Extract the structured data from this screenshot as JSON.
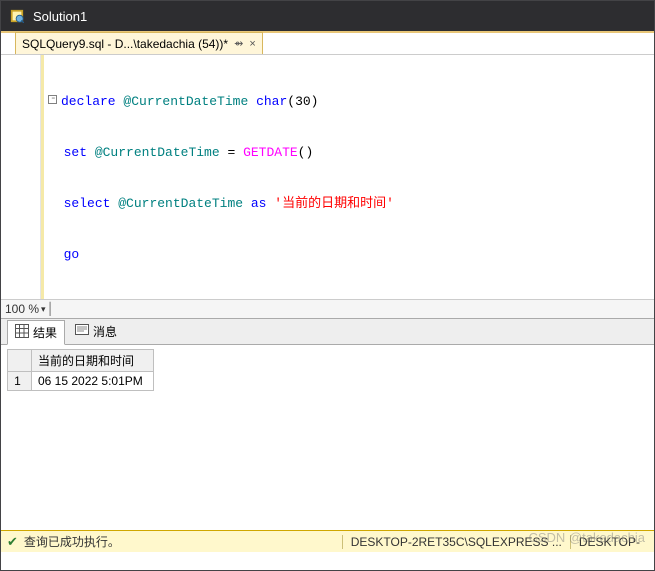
{
  "title_bar": {
    "text": "Solution1"
  },
  "doc_tab": {
    "label": "SQLQuery9.sql - D...\\takedachia (54))*",
    "pin_glyph": "⇴",
    "close_glyph": "×"
  },
  "code": {
    "line1_kw1": "declare",
    "line1_var": "@CurrentDateTime",
    "line1_ty": "char",
    "line1_tail": "(30)",
    "line2_kw": "set",
    "line2_var": "@CurrentDateTime",
    "line2_eq": " = ",
    "line2_fn": "GETDATE",
    "line2_tail": "()",
    "line3_kw": "select",
    "line3_var": "@CurrentDateTime",
    "line3_as": " as ",
    "line3_str": "'当前的日期和时间'",
    "line4_kw": "go"
  },
  "zoom": {
    "label": "100 %"
  },
  "pane_tabs": {
    "results": "结果",
    "messages": "消息"
  },
  "results_grid": {
    "col_header_blank": "",
    "col_header": "当前的日期和时间",
    "rows": [
      {
        "idx": "1",
        "value": "06 15 2022  5:01PM"
      }
    ]
  },
  "status": {
    "ok_glyph": "✔",
    "msg": "查询已成功执行。",
    "server": "DESKTOP-2RET35C\\SQLEXPRESS ...",
    "extra": "DESKTOP-"
  },
  "watermark": "CSDN @takedachia"
}
